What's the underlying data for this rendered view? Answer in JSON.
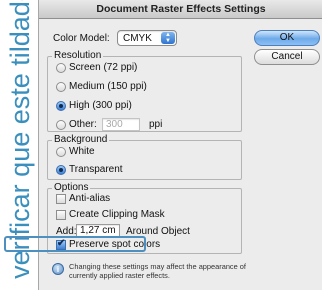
{
  "side_note": "verificar que este tildado",
  "dialog": {
    "title": "Document Raster Effects Settings",
    "color_model": {
      "label": "Color Model:",
      "value": "CMYK"
    },
    "buttons": {
      "ok": "OK",
      "cancel": "Cancel"
    },
    "resolution": {
      "legend": "Resolution",
      "options": [
        "Screen (72 ppi)",
        "Medium (150 ppi)",
        "High (300 ppi)",
        "Other:"
      ],
      "selected": "High (300 ppi)",
      "other_value": "300",
      "other_unit": "ppi"
    },
    "background": {
      "legend": "Background",
      "options": [
        "White",
        "Transparent"
      ],
      "selected": "Transparent"
    },
    "options": {
      "legend": "Options",
      "anti_alias": {
        "label": "Anti-alias",
        "checked": false
      },
      "clipping_mask": {
        "label": "Create Clipping Mask",
        "checked": false
      },
      "add": {
        "label": "Add:",
        "value": "1,27 cm",
        "suffix": "Around Object"
      },
      "preserve_spot": {
        "label": "Preserve spot colors",
        "checked": true
      }
    },
    "info": "Changing these settings may affect the appearance of currently applied raster effects.",
    "colors": {
      "accent": "#3a8fbd",
      "default_button": "#6eaaea"
    }
  }
}
